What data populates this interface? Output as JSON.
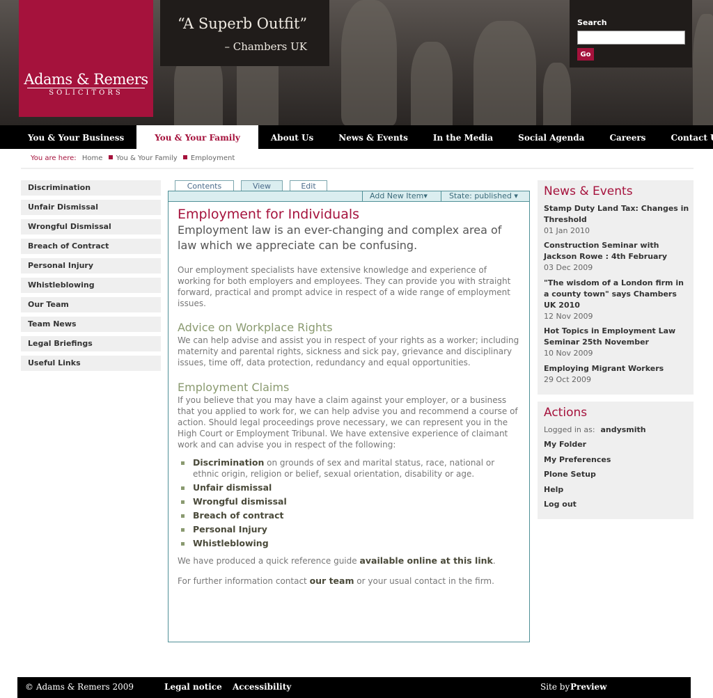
{
  "logo": {
    "name": "Adams & Remers",
    "sub": "SOLICITORS"
  },
  "quote": {
    "text": "“A Superb Outfit”",
    "attribution": "– Chambers UK"
  },
  "search": {
    "label": "Search",
    "button": "Go",
    "placeholder": ""
  },
  "nav": [
    "You & Your Business",
    "You & Your Family",
    "About Us",
    "News & Events",
    "In the Media",
    "Social Agenda",
    "Careers",
    "Contact Us"
  ],
  "breadcrumb": {
    "prefix": "You are here:",
    "items": [
      "Home",
      "You & Your Family",
      "Employment"
    ]
  },
  "leftnav": [
    "Discrimination",
    "Unfair Dismissal",
    "Wrongful Dismissal",
    "Breach of Contract",
    "Personal Injury",
    "Whistleblowing",
    "Our Team",
    "Team News",
    "Legal Briefings",
    "Useful Links"
  ],
  "tabs": [
    "Contents",
    "View",
    "Edit"
  ],
  "actionbar": {
    "add": "Add New Item▾",
    "state": "State: published ▾"
  },
  "content": {
    "title": "Employment for Individuals",
    "description": "Employment law is an ever-changing and complex area of law which we appreciate can be confusing.",
    "intro": "Our employment specialists have extensive knowledge and experience of working for both employers and employees. They can provide you with straight forward, practical and prompt advice in respect of a wide range of employment issues.",
    "h_advice": "Advice on Workplace Rights",
    "p_advice": "We can help advise and assist you in respect of your rights as a worker; including maternity and parental rights, sickness and sick pay, grievance and disciplinary issues, time off, data protection, redundancy and equal opportunities.",
    "h_claims": "Employment Claims",
    "p_claims": "If you believe that you may have a claim against your employer, or a business that you applied to work for, we can help advise you and recommend a course of action. Should legal proceedings prove necessary, we can represent you in the High Court or Employment Tribunal. We have extensive experience of claimant work and can advise you in respect of the following:",
    "list": {
      "discrimination": "Discrimination",
      "discrimination_rest": " on grounds of sex and marital status, race, national or ethnic origin, religion or belief, sexual orientation, disability or age.",
      "items": [
        "Unfair dismissal",
        "Wrongful dismissal",
        "Breach of contract",
        "Personal Injury",
        "Whistleblowing"
      ]
    },
    "guide_pre": "We have produced a quick reference guide ",
    "guide_link": "available online at this link",
    "guide_post": ".",
    "contact_pre": "For further information contact ",
    "contact_link": "our team",
    "contact_post": " or your usual contact in the firm."
  },
  "news": {
    "heading": "News & Events",
    "items": [
      {
        "title": "Stamp Duty Land Tax: Changes in Threshold",
        "date": "01 Jan 2010"
      },
      {
        "title": "Construction Seminar with Jackson Rowe : 4th February",
        "date": "03 Dec 2009"
      },
      {
        "title": "\"The wisdom of a London firm in a county town\" says Chambers UK 2010",
        "date": "12 Nov 2009"
      },
      {
        "title": "Hot Topics in Employment Law Seminar 25th November",
        "date": "10 Nov 2009"
      },
      {
        "title": "Employing Migrant Workers",
        "date": "29 Oct 2009"
      }
    ]
  },
  "actions": {
    "heading": "Actions",
    "logged_label": "Logged in as:",
    "user": "andysmith",
    "links": [
      "My Folder",
      "My Preferences",
      "Plone Setup",
      "Help",
      "Log out"
    ]
  },
  "footer": {
    "copyright": "© Adams & Remers 2009",
    "legal": "Legal notice",
    "accessibility": "Accessibility",
    "site_by": "Site by",
    "preview": "Preview"
  }
}
